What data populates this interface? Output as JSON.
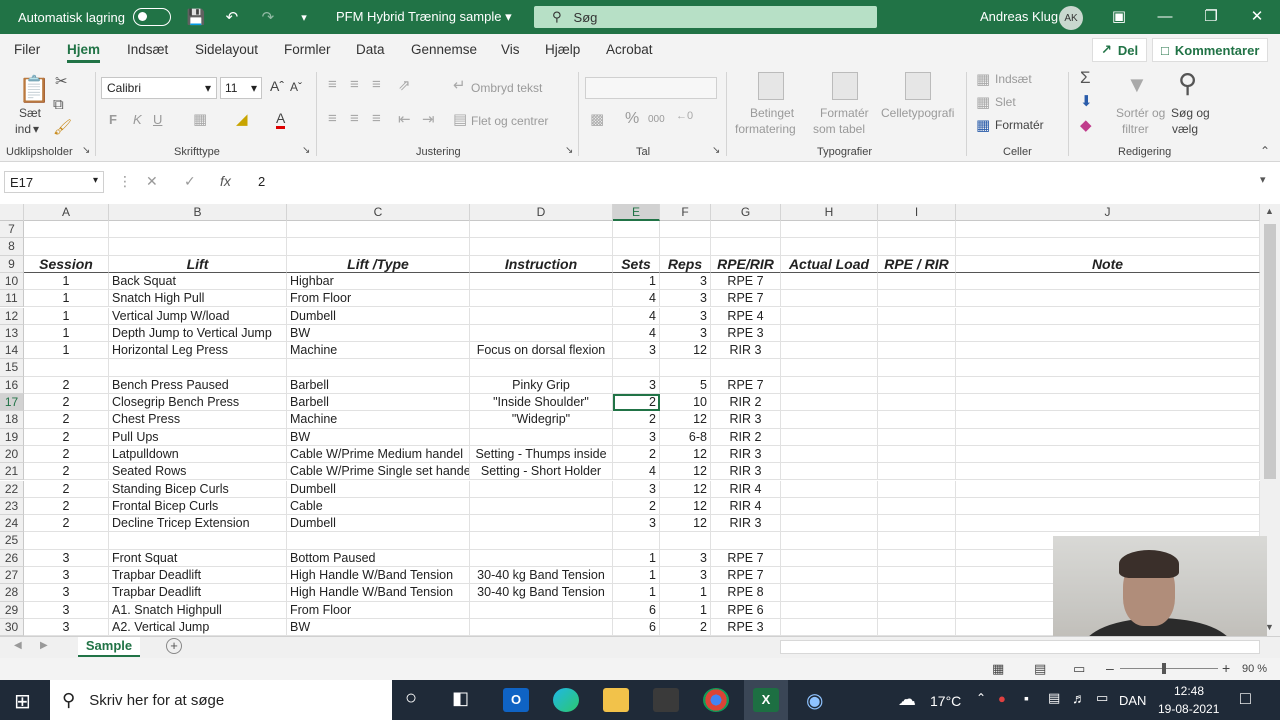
{
  "titlebar": {
    "autosave_label": "Automatisk lagring",
    "doc_title": "PFM Hybrid Træning sample",
    "search_placeholder": "Søg",
    "user_name": "Andreas Klug",
    "user_initials": "AK"
  },
  "menu": {
    "tabs": [
      "Filer",
      "Hjem",
      "Indsæt",
      "Sidelayout",
      "Formler",
      "Data",
      "Gennemse",
      "Vis",
      "Hjælp",
      "Acrobat"
    ],
    "share_label": "Del",
    "comments_label": "Kommentarer"
  },
  "ribbon": {
    "paste_label": "Sæt",
    "paste_label2": "ind",
    "font_name": "Calibri",
    "font_size": "11",
    "wrap_text": "Ombryd tekst",
    "merge_center": "Flet og centrer",
    "conditional_formatting_1": "Betinget",
    "conditional_formatting_2": "formatering",
    "format_as_table_1": "Formatér",
    "format_as_table_2": "som tabel",
    "cell_styles": "Celletypografi",
    "insert": "Indsæt",
    "delete": "Slet",
    "format": "Formatér",
    "sort_filter_1": "Sortér og",
    "sort_filter_2": "filtrer",
    "find_select_1": "Søg og",
    "find_select_2": "vælg",
    "groups": {
      "clipboard": "Udklipsholder",
      "font": "Skrifttype",
      "alignment": "Justering",
      "number": "Tal",
      "styles": "Typografier",
      "cells": "Celler",
      "editing": "Redigering"
    }
  },
  "formula": {
    "name_box": "E17",
    "fx": "fx",
    "value": "2"
  },
  "columns": [
    "A",
    "B",
    "C",
    "D",
    "E",
    "F",
    "G",
    "H",
    "I",
    "J"
  ],
  "headers": {
    "session": "Session",
    "lift": "Lift",
    "lift_type": "Lift /Type",
    "instruction": "Instruction",
    "sets": "Sets",
    "reps": "Reps",
    "rpe_rir": "RPE/RIR",
    "actual_load": "Actual Load",
    "rpe_rir2": "RPE / RIR",
    "note": "Note"
  },
  "row_numbers": [
    "7",
    "8",
    "9",
    "10",
    "11",
    "12",
    "13",
    "14",
    "15",
    "16",
    "17",
    "18",
    "19",
    "20",
    "21",
    "22",
    "23",
    "24",
    "25",
    "26",
    "27",
    "28",
    "29",
    "30"
  ],
  "rows": [
    {
      "n": "10",
      "session": "1",
      "lift": "Back Squat",
      "type": "Highbar",
      "instr": "",
      "sets": "1",
      "reps": "3",
      "rpe": "RPE 7"
    },
    {
      "n": "11",
      "session": "1",
      "lift": "Snatch High Pull",
      "type": "From Floor",
      "instr": "",
      "sets": "4",
      "reps": "3",
      "rpe": "RPE 7"
    },
    {
      "n": "12",
      "session": "1",
      "lift": "Vertical Jump W/load",
      "type": "Dumbell",
      "instr": "",
      "sets": "4",
      "reps": "3",
      "rpe": "RPE 4"
    },
    {
      "n": "13",
      "session": "1",
      "lift": "Depth Jump to Vertical Jump",
      "type": "BW",
      "instr": "",
      "sets": "4",
      "reps": "3",
      "rpe": "RPE 3"
    },
    {
      "n": "14",
      "session": "1",
      "lift": "Horizontal Leg Press",
      "type": "Machine",
      "instr": "Focus on dorsal flexion",
      "sets": "3",
      "reps": "12",
      "rpe": "RIR 3"
    },
    {
      "n": "15",
      "session": "",
      "lift": "",
      "type": "",
      "instr": "",
      "sets": "",
      "reps": "",
      "rpe": ""
    },
    {
      "n": "16",
      "session": "2",
      "lift": "Bench Press Paused",
      "type": "Barbell",
      "instr": "Pinky Grip",
      "sets": "3",
      "reps": "5",
      "rpe": "RPE 7"
    },
    {
      "n": "17",
      "session": "2",
      "lift": "Closegrip Bench Press",
      "type": "Barbell",
      "instr": "\"Inside Shoulder\"",
      "sets": "2",
      "reps": "10",
      "rpe": "RIR 2"
    },
    {
      "n": "18",
      "session": "2",
      "lift": "Chest Press",
      "type": "Machine",
      "instr": "\"Widegrip\"",
      "sets": "2",
      "reps": "12",
      "rpe": "RIR 3"
    },
    {
      "n": "19",
      "session": "2",
      "lift": "Pull Ups",
      "type": "BW",
      "instr": "",
      "sets": "3",
      "reps": "6-8",
      "rpe": "RIR 2"
    },
    {
      "n": "20",
      "session": "2",
      "lift": "Latpulldown",
      "type": "Cable W/Prime Medium handel",
      "instr": "Setting - Thumps inside",
      "sets": "2",
      "reps": "12",
      "rpe": "RIR 3"
    },
    {
      "n": "21",
      "session": "2",
      "lift": "Seated Rows",
      "type": "Cable W/Prime Single set handel",
      "instr": "Setting - Short Holder",
      "sets": "4",
      "reps": "12",
      "rpe": "RIR 3"
    },
    {
      "n": "22",
      "session": "2",
      "lift": "Standing Bicep Curls",
      "type": "Dumbell",
      "instr": "",
      "sets": "3",
      "reps": "12",
      "rpe": "RIR 4"
    },
    {
      "n": "23",
      "session": "2",
      "lift": "Frontal Bicep Curls",
      "type": "Cable",
      "instr": "",
      "sets": "2",
      "reps": "12",
      "rpe": "RIR 4"
    },
    {
      "n": "24",
      "session": "2",
      "lift": "Decline Tricep Extension",
      "type": "Dumbell",
      "instr": "",
      "sets": "3",
      "reps": "12",
      "rpe": "RIR 3"
    },
    {
      "n": "25",
      "session": "",
      "lift": "",
      "type": "",
      "instr": "",
      "sets": "",
      "reps": "",
      "rpe": ""
    },
    {
      "n": "26",
      "session": "3",
      "lift": "Front Squat",
      "type": "Bottom Paused",
      "instr": "",
      "sets": "1",
      "reps": "3",
      "rpe": "RPE 7"
    },
    {
      "n": "27",
      "session": "3",
      "lift": "Trapbar Deadlift",
      "type": "High Handle W/Band Tension",
      "instr": "30-40 kg Band Tension",
      "sets": "1",
      "reps": "3",
      "rpe": "RPE 7"
    },
    {
      "n": "28",
      "session": "3",
      "lift": "Trapbar Deadlift",
      "type": "High Handle W/Band Tension",
      "instr": "30-40 kg Band Tension",
      "sets": "1",
      "reps": "1",
      "rpe": "RPE 8"
    },
    {
      "n": "29",
      "session": "3",
      "lift": "A1. Snatch Highpull",
      "type": "From Floor",
      "instr": "",
      "sets": "6",
      "reps": "1",
      "rpe": "RPE 6"
    },
    {
      "n": "30",
      "session": "3",
      "lift": "A2. Vertical Jump",
      "type": "BW",
      "instr": "",
      "sets": "6",
      "reps": "2",
      "rpe": "RPE 3"
    }
  ],
  "sheet": {
    "tab_name": "Sample",
    "add_sheet": "+"
  },
  "status": {
    "zoom": "90 %"
  },
  "taskbar": {
    "search_placeholder": "Skriv her for at søge",
    "temperature": "17°C",
    "language": "DAN",
    "time": "12:48",
    "date": "19-08-2021",
    "outlook_label": "O",
    "excel_label": "X"
  },
  "colors": {
    "excel_green": "#217346",
    "taskbar": "#1f2a38"
  }
}
